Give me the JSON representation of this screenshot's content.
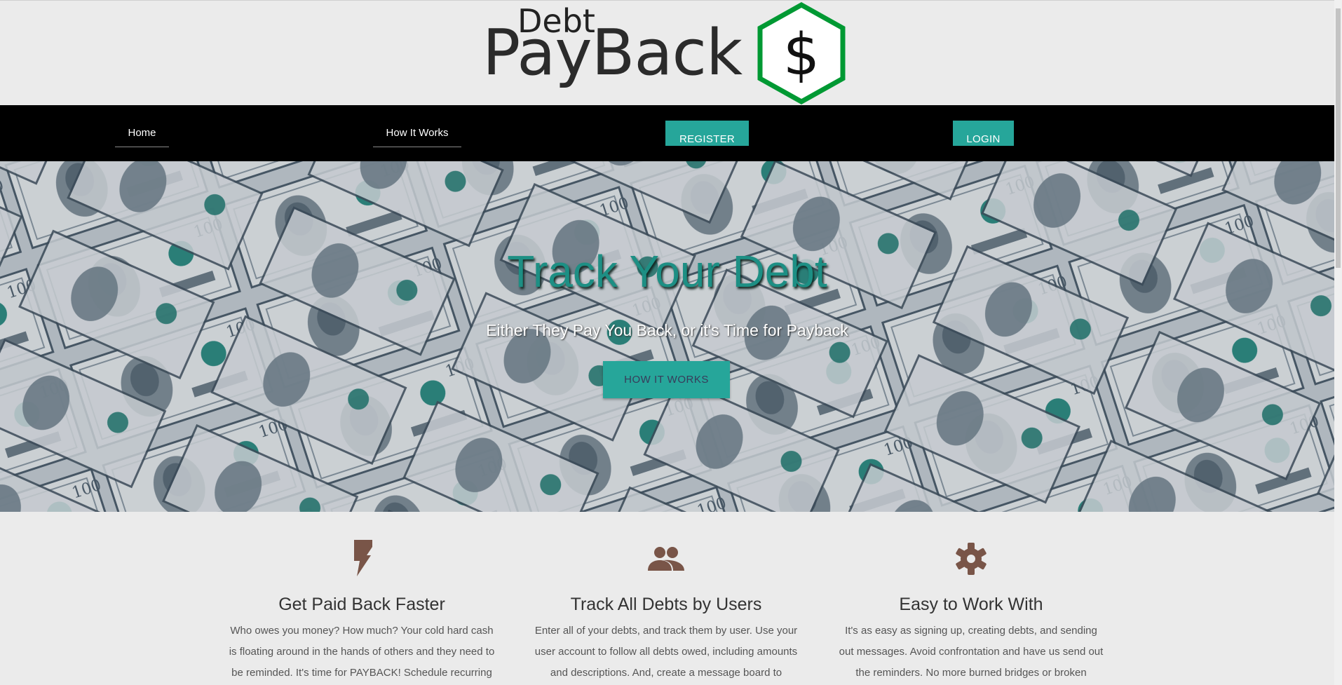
{
  "brand": {
    "logo_top": "Debt",
    "logo_main": "PayBack",
    "logo_symbol": "$",
    "accent": "#009933"
  },
  "nav": {
    "home": "Home",
    "how_it_works": "How It Works",
    "register": "REGISTER",
    "login": "LOGIN"
  },
  "hero": {
    "title": "Track Your Debt",
    "subtitle": "Either They Pay You Back, or it's Time for Payback",
    "button": "HOW IT WORKS",
    "background": "money-bills-image"
  },
  "features": [
    {
      "icon": "flash-icon",
      "title": "Get Paid Back Faster",
      "text": "Who owes you money? How much? Your cold hard cash is floating around in the hands of others and they need to be reminded. It's time for PAYBACK! Schedule recurring"
    },
    {
      "icon": "group-icon",
      "title": "Track All Debts by Users",
      "text": "Enter all of your debts, and track them by user. Use your user account to follow all debts owed, including amounts and descriptions. And, create a message board to quickly"
    },
    {
      "icon": "gear-icon",
      "title": "Easy to Work With",
      "text": "It's as easy as signing up, creating debts, and sending out messages. Avoid confrontation and have us send out the reminders. No more burned bridges or broken"
    }
  ],
  "colors": {
    "teal": "#26a69a",
    "icon_brown": "#795548",
    "nav_bg": "#000000"
  }
}
